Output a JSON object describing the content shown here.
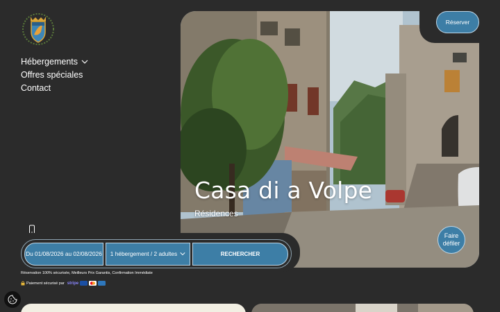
{
  "nav": {
    "items": [
      {
        "label": "Hébergements"
      },
      {
        "label": "Offres spéciales"
      },
      {
        "label": "Contact"
      }
    ]
  },
  "header": {
    "reserve_label": "Réserver"
  },
  "hero": {
    "title": "Casa di a Volpe",
    "subtitle": "Résidences"
  },
  "scroll": {
    "line1": "Faire",
    "line2": "défiler"
  },
  "booking": {
    "dates": "Du 01/08/2026 au 02/08/2026",
    "guests": "1 hébergement / 2 adultes",
    "search_label": "RECHERCHER"
  },
  "footer_note": {
    "secure": "Réservation 100% sécurisée, Meilleurs Prix Garantis, Confirmation Immédiate",
    "payment": "Paiement sécurisé par",
    "payment_brand": "stripe"
  },
  "colors": {
    "background": "#2b2b2b",
    "accent": "#3d7ea6",
    "accent_border": "#bfd6e6",
    "cream_card": "#f2efe3"
  },
  "icons": [
    "crest-logo-icon",
    "chevron-down-icon",
    "phone-icon",
    "cookie-icon",
    "visa-card-icon",
    "mastercard-icon",
    "amex-card-icon"
  ]
}
